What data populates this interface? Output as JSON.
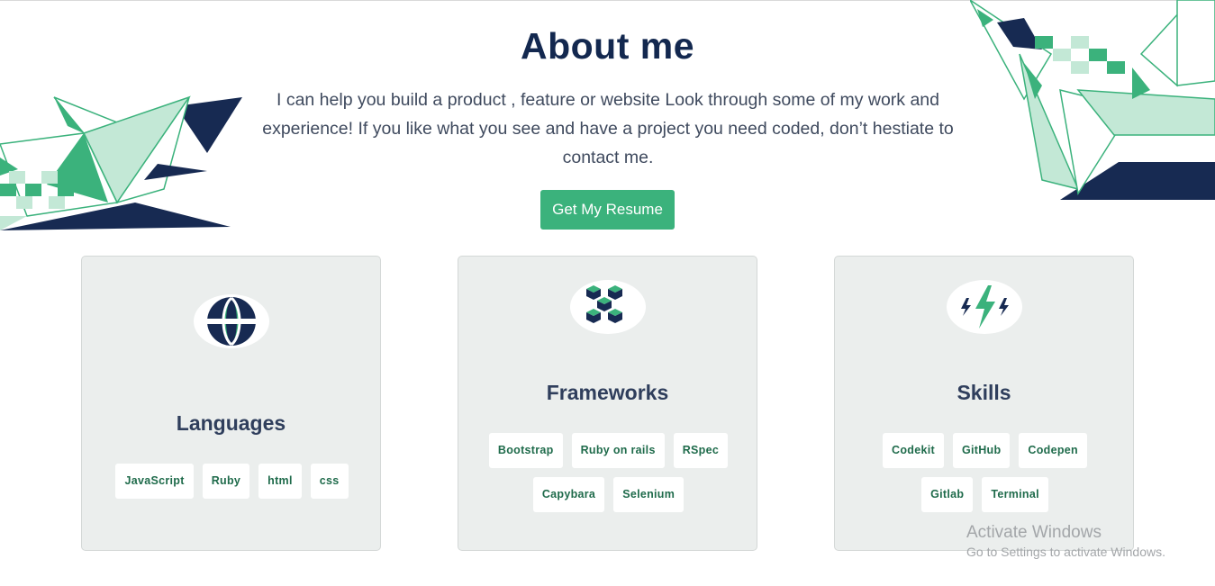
{
  "about": {
    "title": "About me",
    "intro": "I can help you build a product , feature or website Look through some of my work and experience! If you like what you see and have a project you need coded, don’t hestiate to contact me.",
    "resume_button": "Get My Resume"
  },
  "colors": {
    "navy": "#13284f",
    "green": "#3bb27c",
    "light_green": "#c3e8d6",
    "card_bg": "#ebeeed",
    "tag_text": "#1f6b4b"
  },
  "cards": [
    {
      "icon": "globe-icon",
      "title": "Languages",
      "tags": [
        "JavaScript",
        "Ruby",
        "html",
        "css"
      ]
    },
    {
      "icon": "cubes-icon",
      "title": "Frameworks",
      "tags": [
        "Bootstrap",
        "Ruby on rails",
        "RSpec",
        "Capybara",
        "Selenium"
      ]
    },
    {
      "icon": "lightning-icon",
      "title": "Skills",
      "tags": [
        "Codekit",
        "GitHub",
        "Codepen",
        "Gitlab",
        "Terminal"
      ]
    }
  ],
  "watermark": {
    "title": "Activate Windows",
    "subtitle": "Go to Settings to activate Windows."
  }
}
